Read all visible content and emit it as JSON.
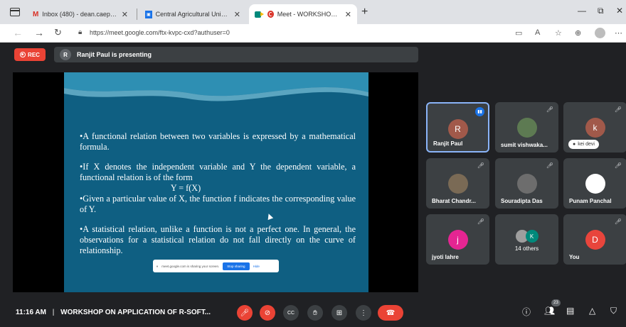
{
  "browser": {
    "tabs": [
      {
        "label": "Inbox (480) - dean.caepht@cau.",
        "icon": "gmail-icon"
      },
      {
        "label": "Central Agricultural University, ",
        "icon": "cau-icon"
      },
      {
        "label": "Meet - WORKSHOP ON AP",
        "icon": "meet-icon",
        "active": true
      }
    ],
    "url": "https://meet.google.com/ftx-kvpc-cxd?authuser=0"
  },
  "meet": {
    "rec_label": "REC",
    "presenter_initial": "R",
    "presenting_text": "Ranjit Paul is presenting",
    "slide": {
      "bullet1": "•A functional relation between two variables is expressed by a mathematical formula.",
      "bullet2": "•If X denotes the independent variable and Y the dependent variable, a functional relation is of the form",
      "formula": "Y = f(X)",
      "bullet3": "•Given a particular value of X, the function f indicates the corresponding value of Y.",
      "bullet4": "•A statistical relation, unlike a function is not a perfect one. In general, the observations for a statistical relation do not fall directly on the curve of relationship."
    },
    "share_bar": {
      "text": "meet.google.com is sharing your screen.",
      "stop": "Stop sharing",
      "hide": "Hide"
    },
    "participants": [
      {
        "name": "Ranjit Paul",
        "initial": "R",
        "color": "#a1594a"
      },
      {
        "name": "sumit vishwaka...",
        "initial": "",
        "color": "#5d7a52"
      },
      {
        "name": "kei devi",
        "initial": "k",
        "color": "#a1594a"
      },
      {
        "name": "Bharat Chandr...",
        "initial": "",
        "color": "#7a6a55"
      },
      {
        "name": "Souradipta Das",
        "initial": "",
        "color": "#6d6d6d"
      },
      {
        "name": "Punam Panchal",
        "initial": "",
        "color": "#ffffff"
      },
      {
        "name": "jyoti lahre",
        "initial": "j",
        "color": "#e52592"
      },
      {
        "name": "14 others",
        "initial": "K",
        "color": "#00897b"
      },
      {
        "name": "You",
        "initial": "D",
        "color": "#e8453c"
      }
    ],
    "time": "11:16 AM",
    "meeting_title": "WORKSHOP ON APPLICATION OF R-SOFT...",
    "participant_count": "23"
  }
}
